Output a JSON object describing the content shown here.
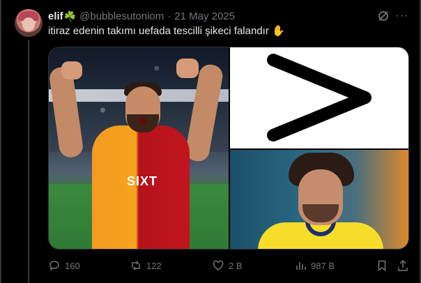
{
  "tweet": {
    "author_name": "elif",
    "author_emoji": "☘️",
    "handle": "@bubblesutoniom",
    "separator": "·",
    "date": "21 May 2025",
    "text": "itiraz edenin takımı uefada tescilli şikeci falandır",
    "text_emoji": "✋",
    "more_glyph": "···"
  },
  "media": {
    "left_sponsor": "SIXT"
  },
  "actions": {
    "replies": "160",
    "reposts": "122",
    "likes": "2 B",
    "views": "987 B"
  },
  "icons": [
    "grok-icon",
    "more-icon",
    "reply-icon",
    "repost-icon",
    "like-icon",
    "views-icon",
    "bookmark-icon",
    "share-icon"
  ],
  "colors": {
    "background": "#000000",
    "text": "#e7e9ea",
    "muted": "#71767b",
    "border": "#2f3336"
  }
}
